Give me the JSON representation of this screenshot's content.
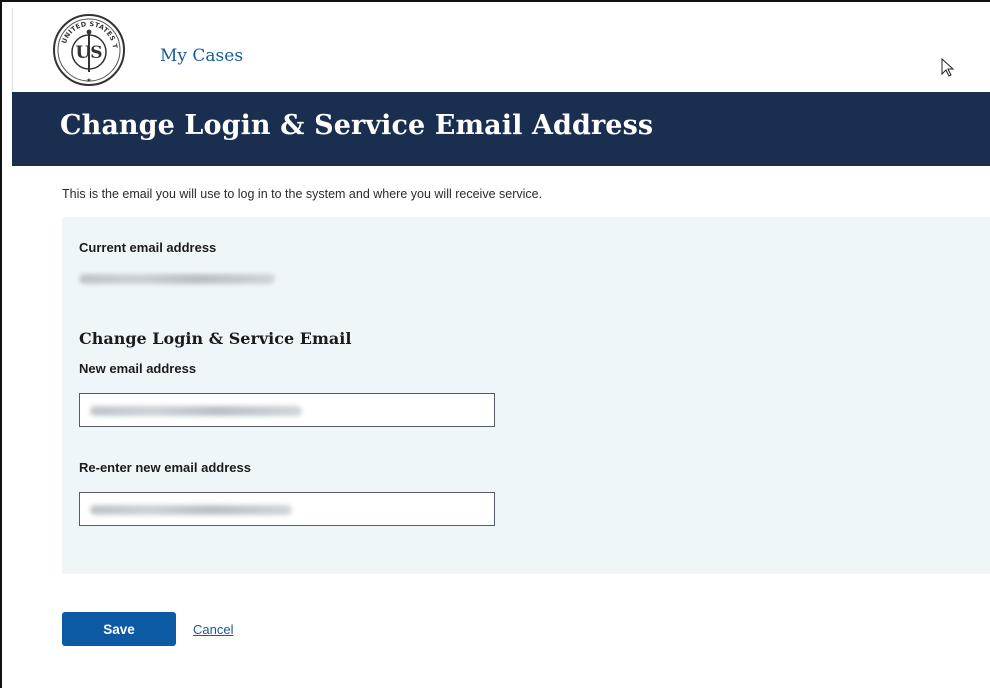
{
  "header": {
    "logo_text_top": "UNITED STATES TAX",
    "logo_text_right": "COURT",
    "logo_monogram": "US",
    "nav_link": "My Cases",
    "logo_icon": "us-tax-court-seal-icon",
    "cursor_icon": "pointer-cursor-icon"
  },
  "banner": {
    "title": "Change Login & Service Email Address"
  },
  "intro": "This is the email you will use to log in to the system and where you will receive service.",
  "current": {
    "label": "Current email address",
    "value": "[blurred]"
  },
  "change_section": {
    "title": "Change Login & Service Email",
    "new_email": {
      "label": "New email address",
      "value": "[blurred]"
    },
    "confirm_email": {
      "label": "Re-enter new email address",
      "value": "[blurred]"
    }
  },
  "actions": {
    "save_label": "Save",
    "cancel_label": "Cancel"
  },
  "colors": {
    "banner": "#1a2f50",
    "primary": "#0b5aa3",
    "link": "#1a5a96",
    "panel": "#eff6fa"
  }
}
